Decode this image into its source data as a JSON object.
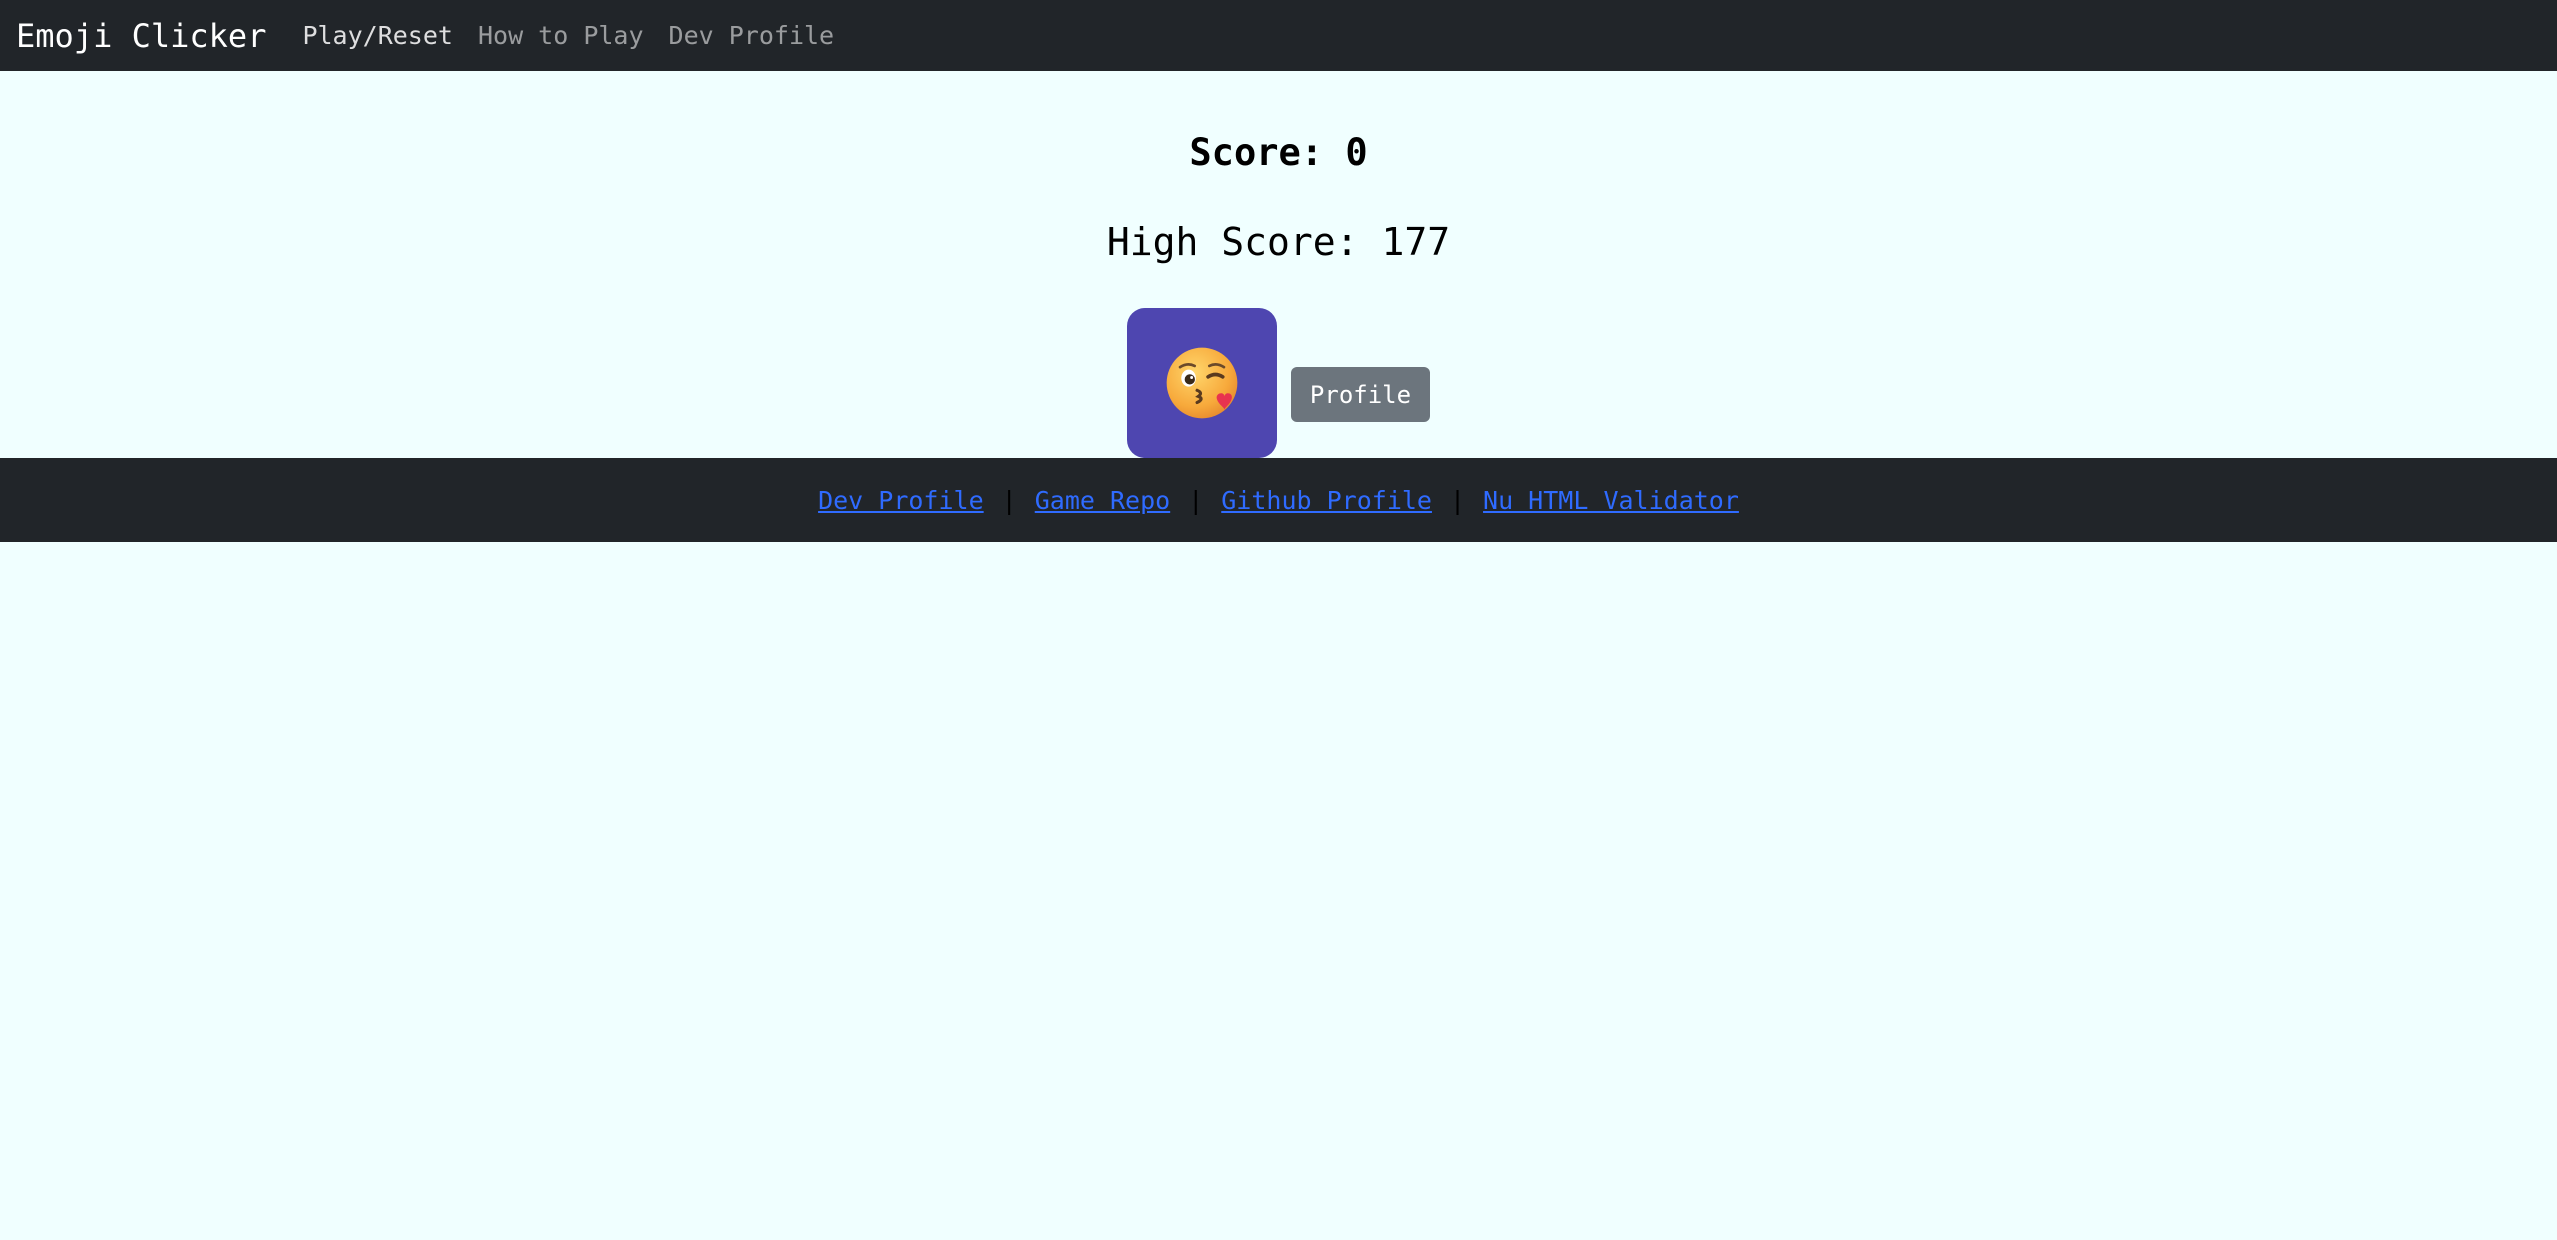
{
  "navbar": {
    "brand": "Emoji Clicker",
    "links": [
      {
        "label": "Play/Reset"
      },
      {
        "label": "How to Play"
      },
      {
        "label": "Dev Profile"
      }
    ]
  },
  "game": {
    "score_text": "Score: 0",
    "high_score_text": "High Score: 177",
    "emoji_icon": "kissing-winking-face-icon",
    "tile_color": "#4e46b0",
    "profile_button_label": "Profile"
  },
  "footer": {
    "links": [
      {
        "label": "Dev Profile"
      },
      {
        "label": "Game Repo"
      },
      {
        "label": "Github Profile"
      },
      {
        "label": "Nu HTML Validator"
      }
    ],
    "separator": "|"
  },
  "colors": {
    "background": "#f0ffff",
    "navbar": "#212529",
    "link": "#2f6bff",
    "button": "#6c757d"
  }
}
